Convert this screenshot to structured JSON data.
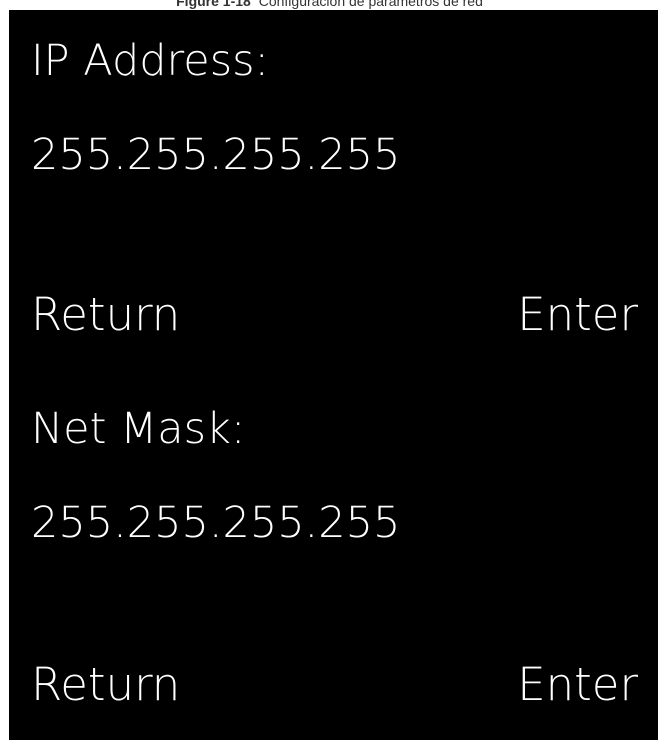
{
  "caption": {
    "figure_number": "Figure 1-18",
    "text": "Configuración de parámetros de red"
  },
  "ip_section": {
    "label": "IP Address:",
    "value": "255.255.255.255",
    "return_label": "Return",
    "enter_label": "Enter"
  },
  "mask_section": {
    "label": "Net Mask:",
    "value": "255.255.255.255",
    "return_label": "Return",
    "enter_label": "Enter"
  },
  "colors": {
    "screen_background": "#000000",
    "text": "#ffffff"
  }
}
